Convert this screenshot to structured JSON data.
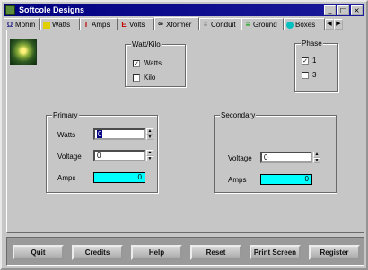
{
  "window": {
    "title": "Softcole Designs"
  },
  "title_buttons": [
    "_",
    "□",
    "×"
  ],
  "tabs": [
    {
      "label": "Mohm",
      "icon": "ohm-icon",
      "color": "#2a2a8a"
    },
    {
      "label": "Watts",
      "icon": "watts-icon",
      "color": "#d0c000"
    },
    {
      "label": "Amps",
      "icon": "amps-icon",
      "color": "#c00000"
    },
    {
      "label": "Volts",
      "icon": "volts-icon",
      "color": "#c00000"
    },
    {
      "label": "Xformer",
      "icon": "transformer-icon",
      "color": "#202020",
      "active": true
    },
    {
      "label": "Conduit",
      "icon": "conduit-icon",
      "color": "#808080"
    },
    {
      "label": "Ground",
      "icon": "ground-icon",
      "color": "#00a000"
    },
    {
      "label": "Boxes",
      "icon": "boxes-icon",
      "color": "#00a0a0"
    }
  ],
  "tab_scroll": {
    "left": "◀",
    "right": "▶"
  },
  "watt_kilo": {
    "title": "Watt/Kilo",
    "watts": "Watts",
    "kilo": "Kilo",
    "watts_checked": true,
    "kilo_checked": false,
    "check_mark": "✓"
  },
  "phase": {
    "title": "Phase",
    "opt1": "1",
    "opt3": "3",
    "opt1_checked": true,
    "opt3_checked": false,
    "check_mark": "✓"
  },
  "primary": {
    "title": "Primary",
    "watts_label": "Watts",
    "watts_value": "0",
    "voltage_label": "Voltage",
    "voltage_value": "0",
    "amps_label": "Amps",
    "amps_value": "0"
  },
  "secondary": {
    "title": "Secondary",
    "voltage_label": "Voltage",
    "voltage_value": "0",
    "amps_label": "Amps",
    "amps_value": "0"
  },
  "spin": {
    "up": "▲",
    "down": "▼"
  },
  "buttons": {
    "quit": "Quit",
    "credits": "Credits",
    "help": "Help",
    "reset": "Reset",
    "print": "Print Screen",
    "register": "Register"
  }
}
